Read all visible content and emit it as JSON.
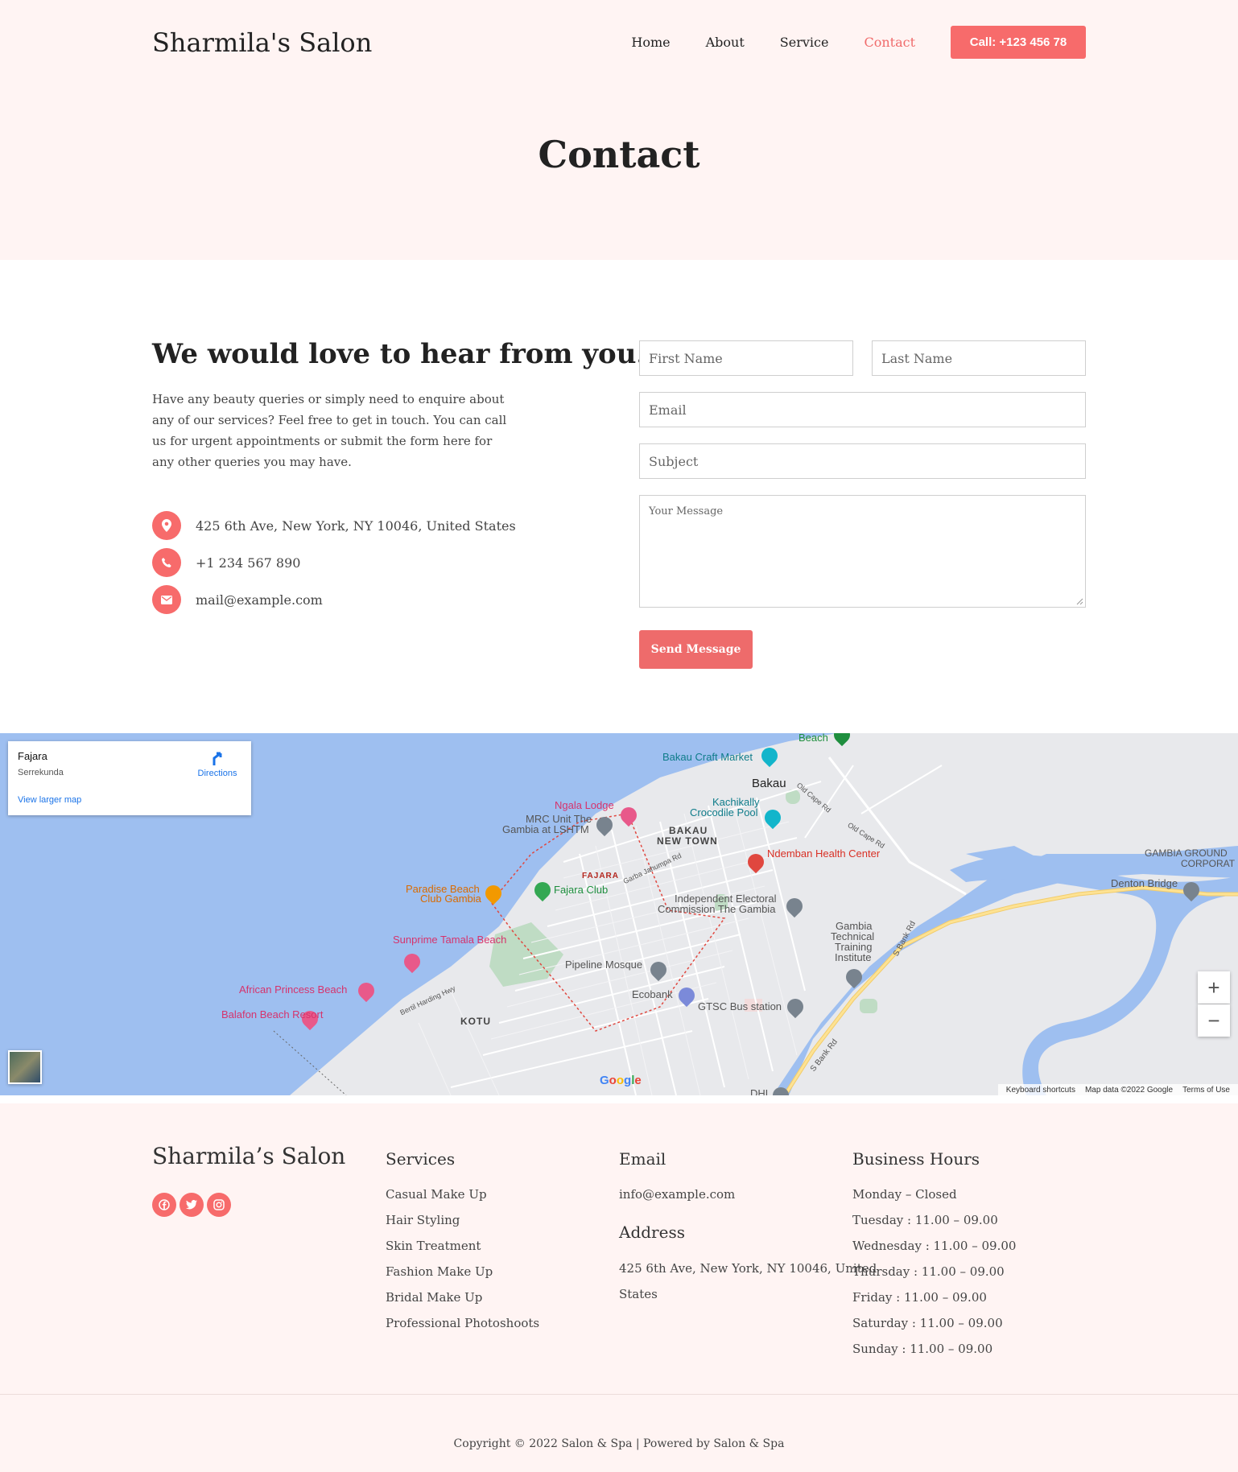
{
  "header": {
    "logo": "Sharmila's Salon",
    "nav": [
      "Home",
      "About",
      "Service",
      "Contact"
    ],
    "active_nav": "Contact",
    "call_button": "Call: +123 456 78"
  },
  "hero": {
    "title": "Contact"
  },
  "contact": {
    "heading": "We would love to hear from you.",
    "intro": "Have any beauty queries or simply need to enquire about any of our services? Feel free to get in touch. You can call us for urgent appointments or submit the form here for any other queries you may have.",
    "address": "425 6th Ave, New York, NY 10046, United States",
    "phone": "+1 234 567 890",
    "email": "mail@example.com",
    "form": {
      "first_name_placeholder": "First Name",
      "last_name_placeholder": "Last Name",
      "email_placeholder": "Email",
      "subject_placeholder": "Subject",
      "message_placeholder": "Your Message",
      "send_label": "Send Message"
    }
  },
  "map": {
    "place_title": "Fajara",
    "place_subtitle": "Serrekunda",
    "directions_label": "Directions",
    "larger_map_label": "View larger map",
    "labels": {
      "beach": "Beach",
      "bakau_craft_market": "Bakau Craft Market",
      "bakau": "Bakau",
      "old_cape_rd_1": "Old Cape Rd",
      "old_cape_rd_2": "Old Cape Rd",
      "ngala_lodge": "Ngala Lodge",
      "kachikally": "Kachikally",
      "crocodile_pool": "Crocodile Pool",
      "mrc_1": "MRC Unit The",
      "mrc_2": "Gambia at LSHTM",
      "bakau_new_town_1": "BAKAU",
      "bakau_new_town_2": "NEW TOWN",
      "ndemban": "Ndemban Health Center",
      "gambia_ground_1": "GAMBIA GROUND",
      "gambia_ground_2": "CORPORAT",
      "denton_bridge": "Denton Bridge",
      "fajara_caps": "FAJARA",
      "garba_jahumpa": "Garba Jahumpa Rd",
      "paradise_1": "Paradise Beach",
      "paradise_2": "Club Gambia",
      "fajara_club": "Fajara Club",
      "iec_1": "Independent Electoral",
      "iec_2": "Commission The Gambia",
      "gtti_1": "Gambia",
      "gtti_2": "Technical",
      "gtti_3": "Training",
      "gtti_4": "Institute",
      "s_bank_rd_1": "S Bank Rd",
      "s_bank_rd_2": "S Bank Rd",
      "sunprime": "Sunprime Tamala Beach",
      "pipeline": "Pipeline Mosque",
      "african_princess": "African Princess Beach",
      "ecobank": "Ecobank",
      "gtsc": "GTSC Bus station",
      "balafon": "Balafon Beach Resort",
      "bertil": "Bertil Harding Hwy",
      "kotu": "KOTU",
      "dhl": "DHL"
    },
    "google": "Google",
    "zoom_in": "+",
    "zoom_out": "−",
    "attribution": [
      "Keyboard shortcuts",
      "Map data ©2022 Google",
      "Terms of Use"
    ]
  },
  "footer": {
    "logo": "Sharmila’s Salon",
    "social": [
      "facebook-icon",
      "twitter-icon",
      "instagram-icon"
    ],
    "services_heading": "Services",
    "services": [
      "Casual Make Up",
      "Hair Styling",
      "Skin Treatment",
      "Fashion Make Up",
      "Bridal Make Up",
      "Professional Photoshoots"
    ],
    "email_heading": "Email",
    "email": "info@example.com",
    "address_heading": "Address",
    "address_line1": "425 6th Ave, New York, NY 10046, United",
    "address_line2": "States",
    "hours_heading": "Business Hours",
    "hours": [
      "Monday – Closed",
      "Tuesday : 11.00 – 09.00",
      "Wednesday : 11.00 – 09.00",
      "Thursday : 11.00 – 09.00",
      "Friday : 11.00 – 09.00",
      "Saturday : 11.00 – 09.00",
      "Sunday : 11.00 – 09.00"
    ],
    "copyright": "Copyright © 2022 Salon & Spa | Powered by Salon & Spa"
  },
  "colors": {
    "accent": "#f76b6b",
    "hero_bg": "#fff4f3",
    "map_water": "#9ebff0"
  }
}
